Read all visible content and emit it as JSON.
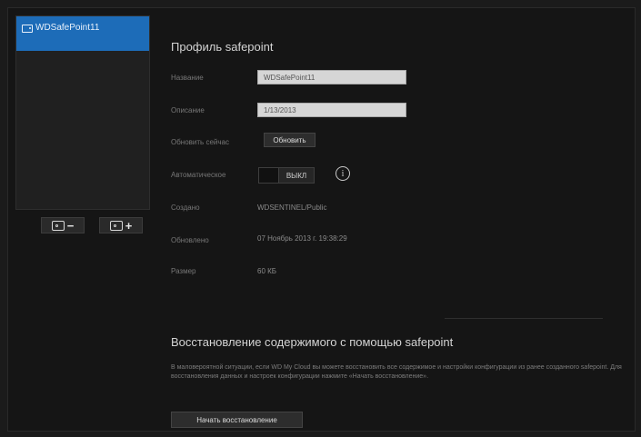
{
  "sidebar": {
    "items": [
      {
        "label": "WDSafePoint11",
        "icon": "drive-icon",
        "selected": true
      }
    ]
  },
  "toolbar": {
    "remove_icon": "drive-remove-icon",
    "add_icon": "drive-add-icon",
    "remove_sign": "−",
    "add_sign": "+"
  },
  "profile": {
    "title": "Профиль safepoint",
    "name_label": "Название",
    "name_value": "WDSafePoint11",
    "description_label": "Описание",
    "description_value": "1/13/2013",
    "update_now_label": "Обновить сейчас",
    "update_button": "Обновить",
    "auto_update_label": "Автоматическое",
    "auto_update_state": "ВЫКЛ",
    "info_icon": "i",
    "created_label": "Создано",
    "created_value": "WDSENTINEL/Public",
    "updated_label": "Обновлено",
    "updated_value": "07 Ноябрь 2013 г. 19:38:29",
    "size_label": "Размер",
    "size_value": "60 КБ"
  },
  "restore": {
    "title": "Восстановление содержимого с помощью safepoint",
    "description": "В маловероятной ситуации, если WD My Cloud вы можете восстановить все содержимое и настройки конфигурации из ранее созданного safepoint. Для восстановления данных и настроек конфигурации нажмите «Начать восстановление».",
    "button": "Начать восстановление"
  },
  "colors": {
    "selected_item": "#1d6cb8",
    "background": "#151515"
  }
}
